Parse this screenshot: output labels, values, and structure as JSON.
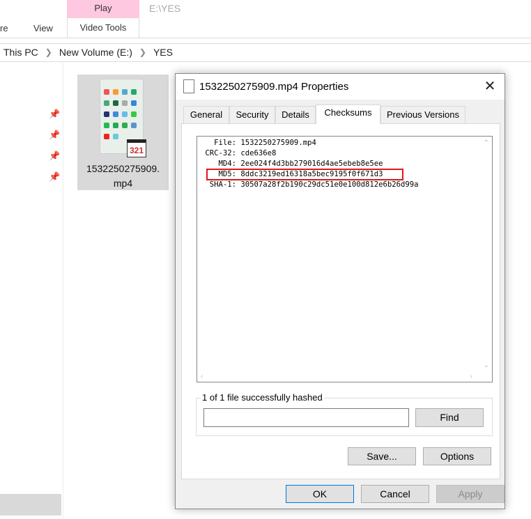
{
  "ribbon": {
    "tabs": [
      "re",
      "View"
    ],
    "contextual_group": "Play",
    "contextual_tab": "Video Tools",
    "path_title": "E:\\YES"
  },
  "breadcrumb": [
    "This PC",
    "New Volume (E:)",
    "YES"
  ],
  "file": {
    "name_line1": "1532250275909.",
    "name_line2": "mp4",
    "badge": "321"
  },
  "dialog": {
    "title": "1532250275909.mp4 Properties",
    "tabs": [
      {
        "label": "General"
      },
      {
        "label": "Security"
      },
      {
        "label": "Details"
      },
      {
        "label": "Checksums",
        "active": true
      },
      {
        "label": "Previous Versions"
      }
    ],
    "checksums": {
      "file_line": "   File: 1532250275909.mp4",
      "crc_line": " CRC-32: cde636e8",
      "md4_line": "    MD4: 2ee024f4d3bb279016d4ae5ebeb8e5ee",
      "md5_line": "    MD5: 8ddc3219ed16318a5bec9195f0f671d3",
      "sha1_line": "  SHA-1: 30507a28f2b190c29dc51e0e100d812e6b26d99a",
      "highlight_color": "#e0161a"
    },
    "status": "1 of 1 file successfully hashed",
    "find_value": "",
    "buttons": {
      "find": "Find",
      "save": "Save...",
      "options": "Options",
      "ok": "OK",
      "cancel": "Cancel",
      "apply": "Apply"
    }
  }
}
